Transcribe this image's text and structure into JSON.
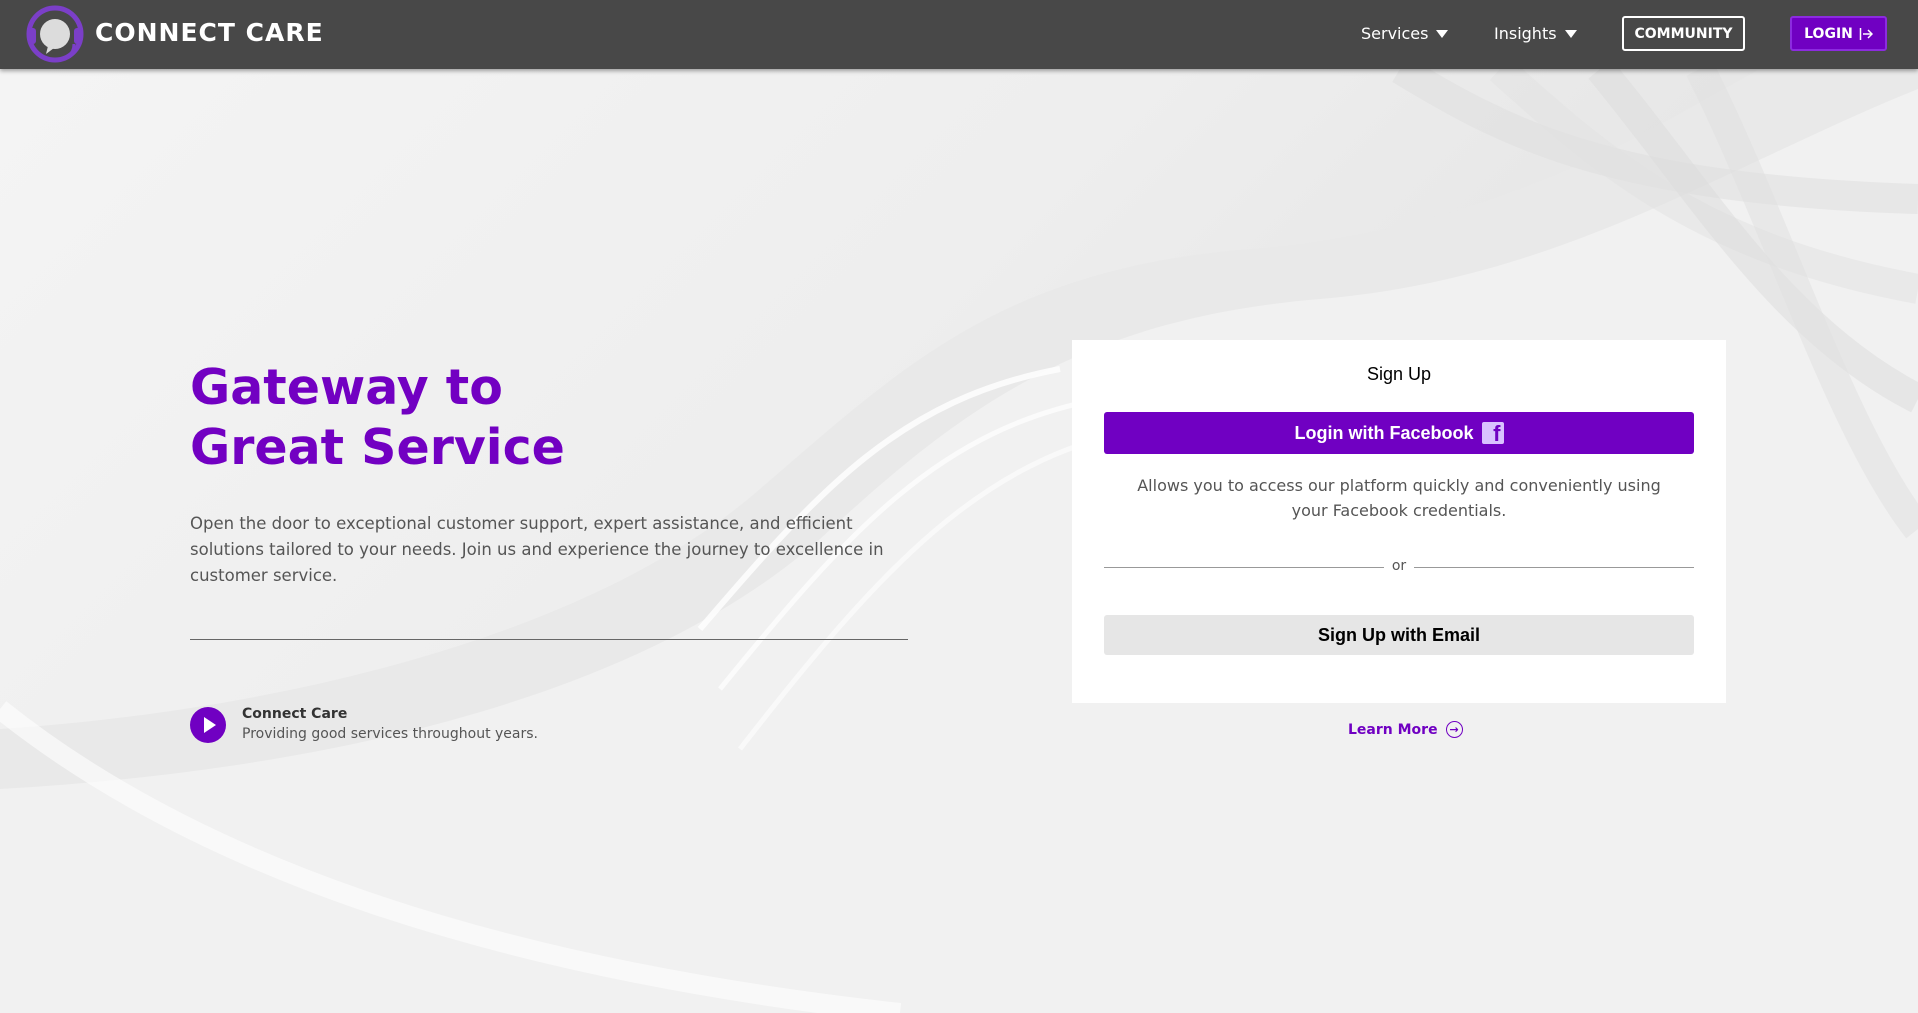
{
  "colors": {
    "accent": "#7000c2",
    "navbar": "#484848",
    "card": "#ffffff"
  },
  "navbar": {
    "brand": "CONNECT CARE",
    "logo_icon": "headset-chat-icon",
    "menu": [
      {
        "label": "Services",
        "icon": "caret-down-icon"
      },
      {
        "label": "Insights",
        "icon": "caret-down-icon"
      }
    ],
    "community_label": "COMMUNITY",
    "login_label": "LOGIN",
    "login_icon": "login-arrow-icon"
  },
  "hero": {
    "title_line1": "Gateway to",
    "title_line2": "Great Service",
    "description": "Open the door to exceptional customer support, expert assistance, and efficient solutions tailored to your needs. Join us and experience the journey to excellence in customer service.",
    "brand_name": "Connect Care",
    "tagline": "Providing good services throughout years."
  },
  "signup": {
    "title": "Sign Up",
    "facebook_label": "Login with Facebook",
    "facebook_icon": "facebook-icon",
    "facebook_description": "Allows you to access our platform quickly and conveniently using your Facebook credentials.",
    "divider_text": "or",
    "email_label": "Sign Up with Email"
  },
  "learn_more": {
    "label": "Learn More",
    "icon": "arrow-right-circle-icon"
  }
}
